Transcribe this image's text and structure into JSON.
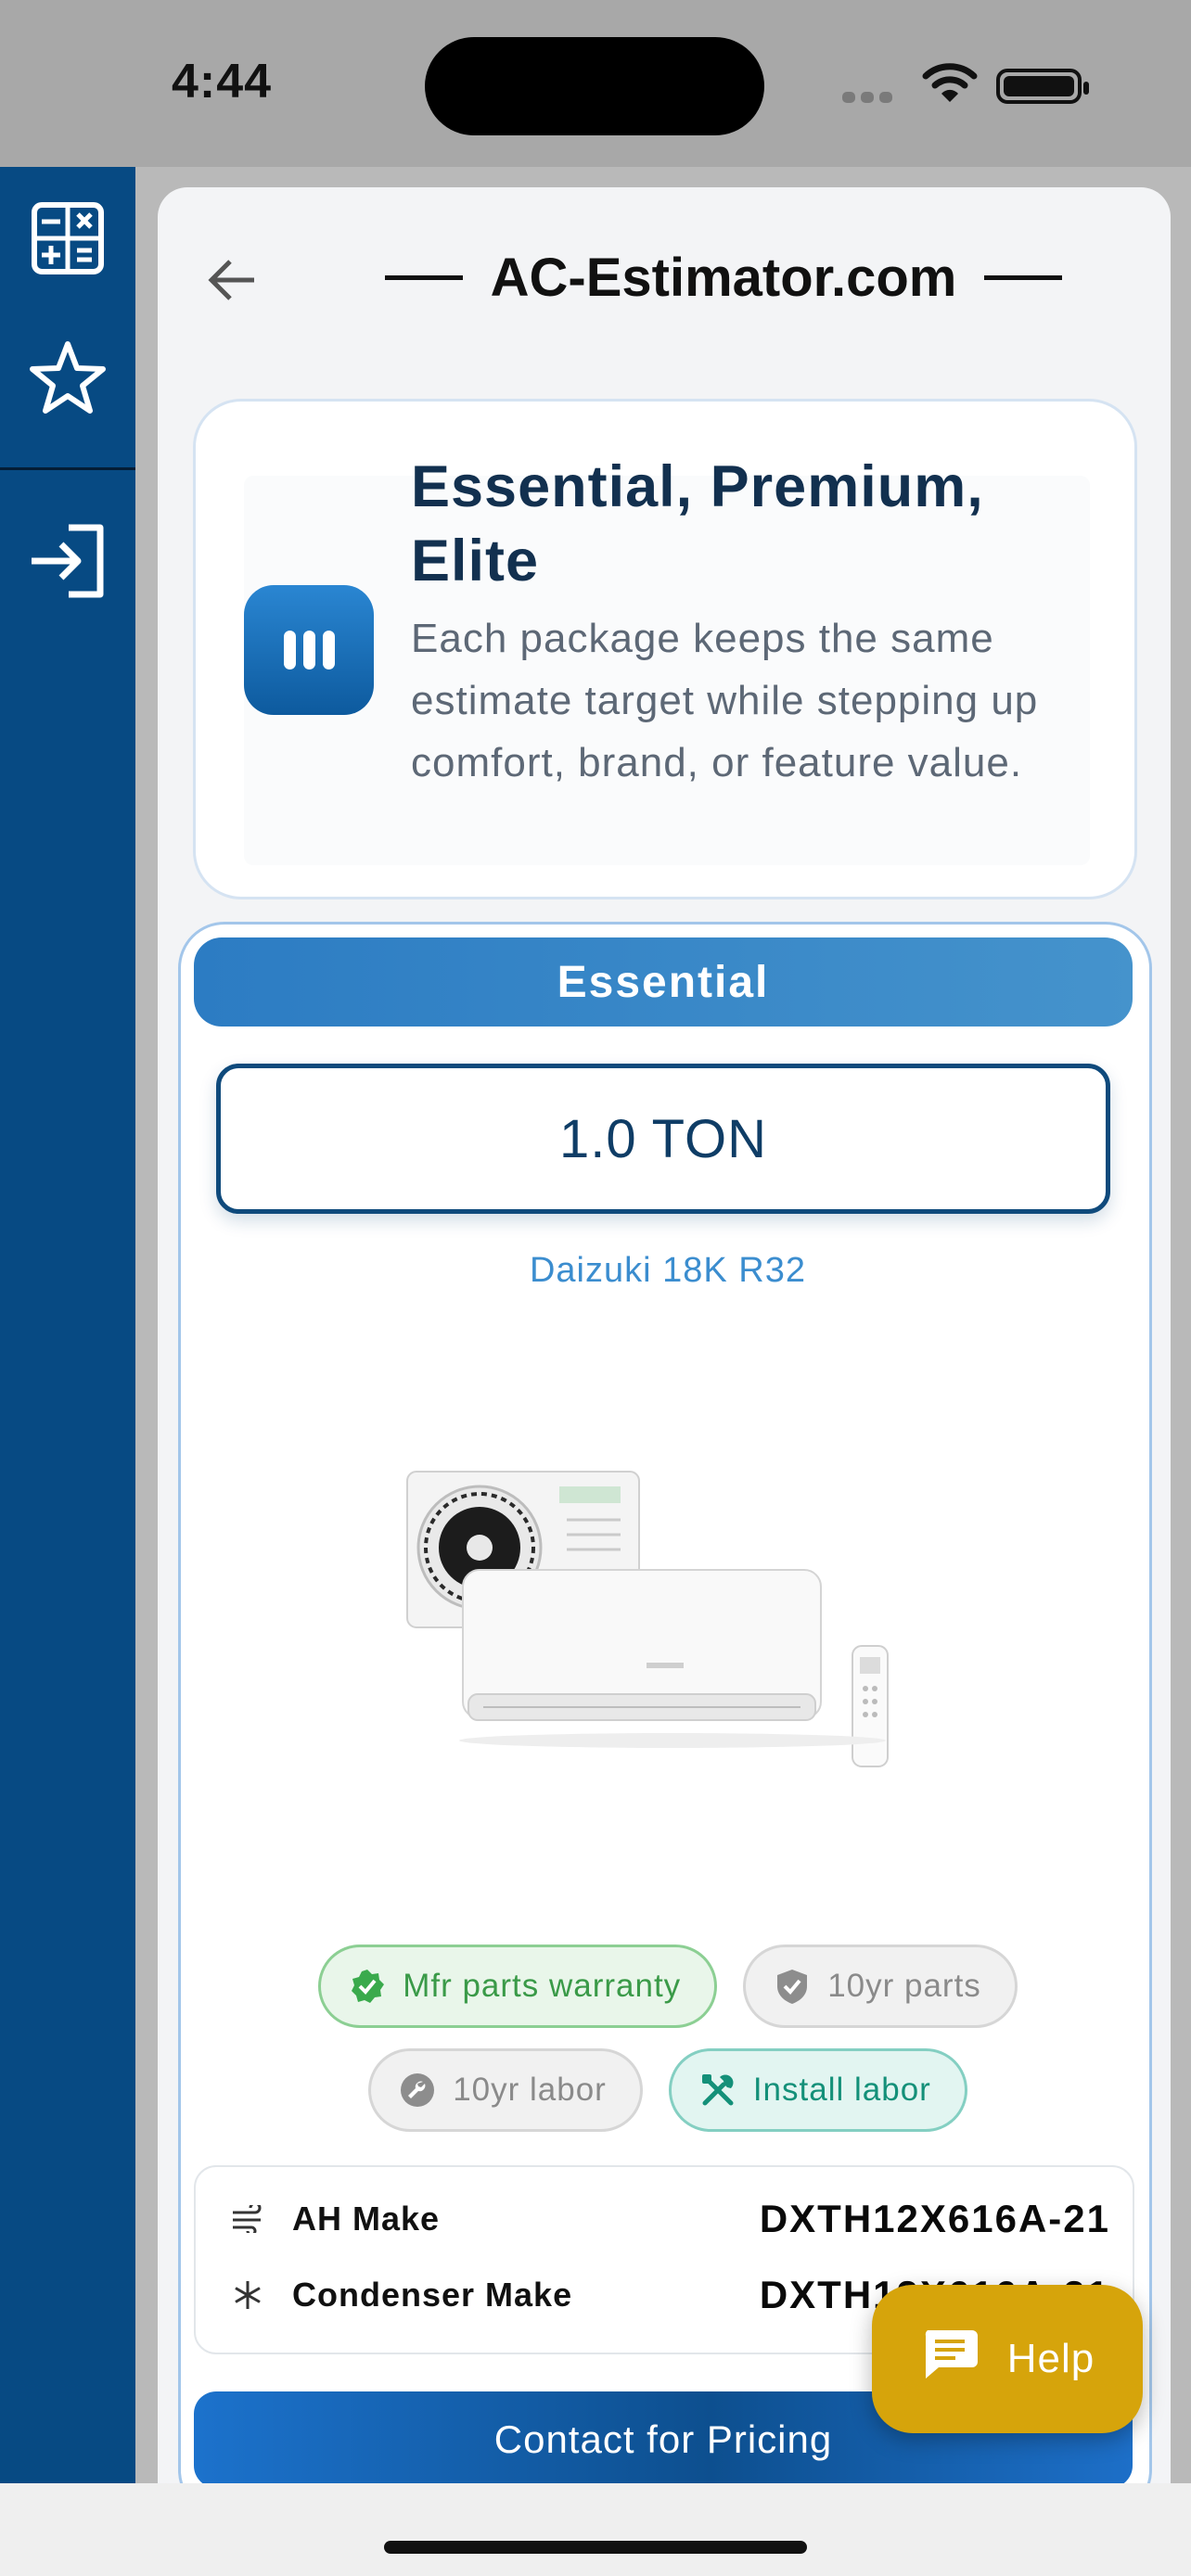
{
  "status_bar": {
    "time": "4:44"
  },
  "sidebar": {
    "items": [
      {
        "icon": "calculator-icon"
      },
      {
        "icon": "star-outline-icon"
      },
      {
        "icon": "login-icon"
      }
    ]
  },
  "header": {
    "title": "AC-Estimator.com",
    "back_icon": "arrow-left-icon"
  },
  "intro": {
    "title": "Essential, Premium, Elite",
    "description": "Each package keeps the same estimate target while stepping up comfort, brand, or feature value.",
    "icon": "package-tiers-icon"
  },
  "tier": {
    "name": "Essential",
    "tonnage": "1.0 TON",
    "model": "Daizuki 18K R32",
    "image_alt": "Daizuki mini split system",
    "badges": [
      {
        "label": "Mfr parts warranty",
        "icon": "check-badge-icon",
        "style": "green"
      },
      {
        "label": "10yr parts",
        "icon": "shield-icon",
        "style": "gray"
      },
      {
        "label": "10yr labor",
        "icon": "wrench-icon",
        "style": "gray"
      },
      {
        "label": "Install labor",
        "icon": "tools-icon",
        "style": "teal"
      }
    ],
    "specs": [
      {
        "label": "AH Make",
        "value": "DXTH12X616A-21",
        "icon": "air-handler-icon"
      },
      {
        "label": "Condenser Make",
        "value": "DXTH12X616A-21",
        "icon": "snowflake-icon"
      }
    ],
    "cta_label": "Contact for Pricing"
  },
  "help": {
    "label": "Help",
    "icon": "chat-icon"
  },
  "colors": {
    "sidebar": "#074a83",
    "primary": "#1c72cc",
    "help": "#d6a40b",
    "title_text": "#12304f"
  }
}
